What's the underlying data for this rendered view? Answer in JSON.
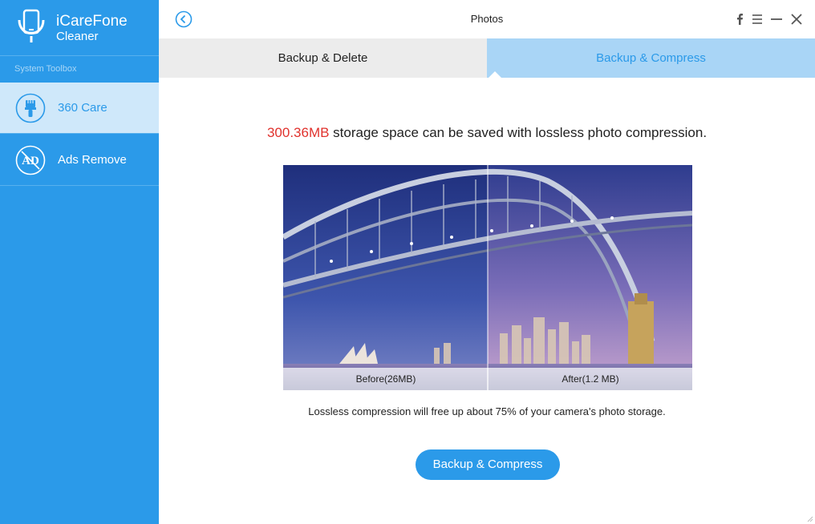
{
  "app": {
    "name": "iCareFone",
    "sub": "Cleaner"
  },
  "sidebar": {
    "section_label": "System Toolbox",
    "items": [
      {
        "label": "360 Care",
        "icon": "brush-icon",
        "active": true
      },
      {
        "label": "Ads Remove",
        "icon": "ad-block-icon",
        "active": false
      }
    ]
  },
  "titlebar": {
    "title": "Photos",
    "controls": [
      "facebook-icon",
      "menu-icon",
      "minimize-icon",
      "close-icon"
    ]
  },
  "tabs": [
    {
      "label": "Backup  & Delete",
      "active": false
    },
    {
      "label": "Backup  & Compress",
      "active": true
    }
  ],
  "content": {
    "saved_size": "300.36MB",
    "headline_rest": " storage space can be saved with lossless photo compression.",
    "before_label": "Before(26MB)",
    "after_label": "After(1.2 MB)",
    "caption": "Lossless compression will free up about 75% of your camera's photo storage.",
    "action_label": "Backup & Compress"
  },
  "colors": {
    "accent": "#2b9ae9",
    "highlight": "#e0322d",
    "tab_active": "#a9d5f6",
    "tab_inactive": "#ececec"
  }
}
